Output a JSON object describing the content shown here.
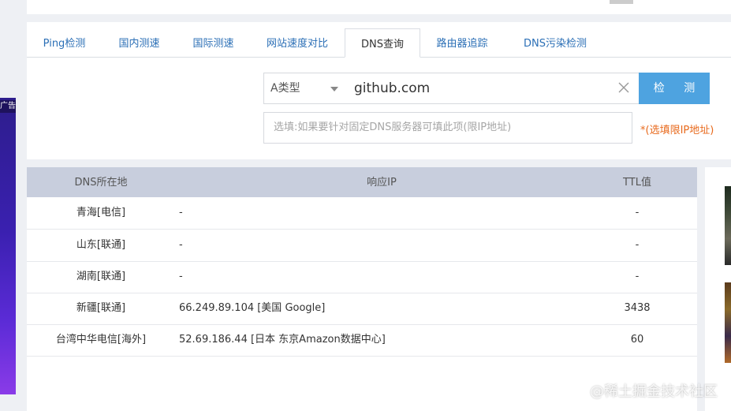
{
  "tabs": [
    {
      "label": "Ping检测",
      "active": false
    },
    {
      "label": "国内测速",
      "active": false
    },
    {
      "label": "国际测速",
      "active": false
    },
    {
      "label": "网站速度对比",
      "active": false
    },
    {
      "label": "DNS查询",
      "active": true
    },
    {
      "label": "路由器追踪",
      "active": false
    },
    {
      "label": "DNS污染检测",
      "active": false
    }
  ],
  "query": {
    "record_type": "A类型",
    "domain_value": "github.com",
    "button_label": "检 测",
    "dns_placeholder": "选填:如果要针对固定DNS服务器可填此项(限IP地址)",
    "dns_hint": "*(选填限IP地址)"
  },
  "table": {
    "headers": {
      "location": "DNS所在地",
      "ip": "响应IP",
      "ttl": "TTL值"
    },
    "rows": [
      {
        "location": "青海[电信]",
        "ip": "-",
        "ttl": "-"
      },
      {
        "location": "山东[联通]",
        "ip": "-",
        "ttl": "-"
      },
      {
        "location": "湖南[联通]",
        "ip": "-",
        "ttl": "-"
      },
      {
        "location": "新疆[联通]",
        "ip": "66.249.89.104 [美国 Google]",
        "ttl": "3438"
      },
      {
        "location": "台湾中华电信[海外]",
        "ip": "52.69.186.44 [日本 东京Amazon数据中心]",
        "ttl": "60"
      }
    ]
  },
  "left_ad": {
    "label": "广告"
  },
  "watermark": "@稀土掘金技术社区",
  "colors": {
    "tab_link": "#2b6fb6",
    "button_bg": "#4ea3e0",
    "hint": "#e86a1d",
    "table_header_bg": "#c8cedd"
  }
}
